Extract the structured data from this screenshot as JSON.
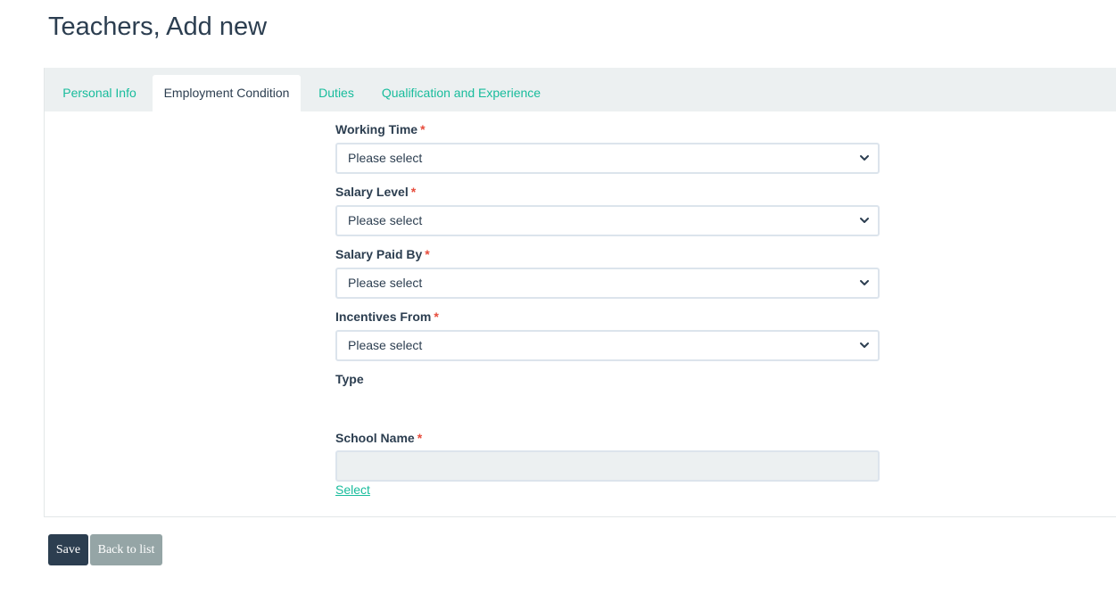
{
  "page": {
    "title": "Teachers, Add new"
  },
  "tabs": [
    {
      "label": "Personal Info",
      "active": false
    },
    {
      "label": "Employment Condition",
      "active": true
    },
    {
      "label": "Duties",
      "active": false
    },
    {
      "label": "Qualification and Experience",
      "active": false
    }
  ],
  "form": {
    "working_time": {
      "label": "Working Time",
      "required_mark": "*",
      "value": "Please select"
    },
    "salary_level": {
      "label": "Salary Level",
      "required_mark": "*",
      "value": "Please select"
    },
    "salary_paid_by": {
      "label": "Salary Paid By",
      "required_mark": "*",
      "value": "Please select"
    },
    "incentives_from": {
      "label": "Incentives From",
      "required_mark": "*",
      "value": "Please select"
    },
    "type": {
      "label": "Type"
    },
    "school_name": {
      "label": "School Name",
      "required_mark": "*",
      "value": "",
      "link": "Select"
    }
  },
  "actions": {
    "save": "Save",
    "back": "Back to list"
  },
  "icons": {
    "select_arrow": "chevron-down-icon"
  },
  "colors": {
    "primary": "#2c3e50",
    "accent": "#18bc9c",
    "required": "#e74c3c",
    "tab_background": "#ecf0f1",
    "secondary_button": "#95a5a6"
  }
}
